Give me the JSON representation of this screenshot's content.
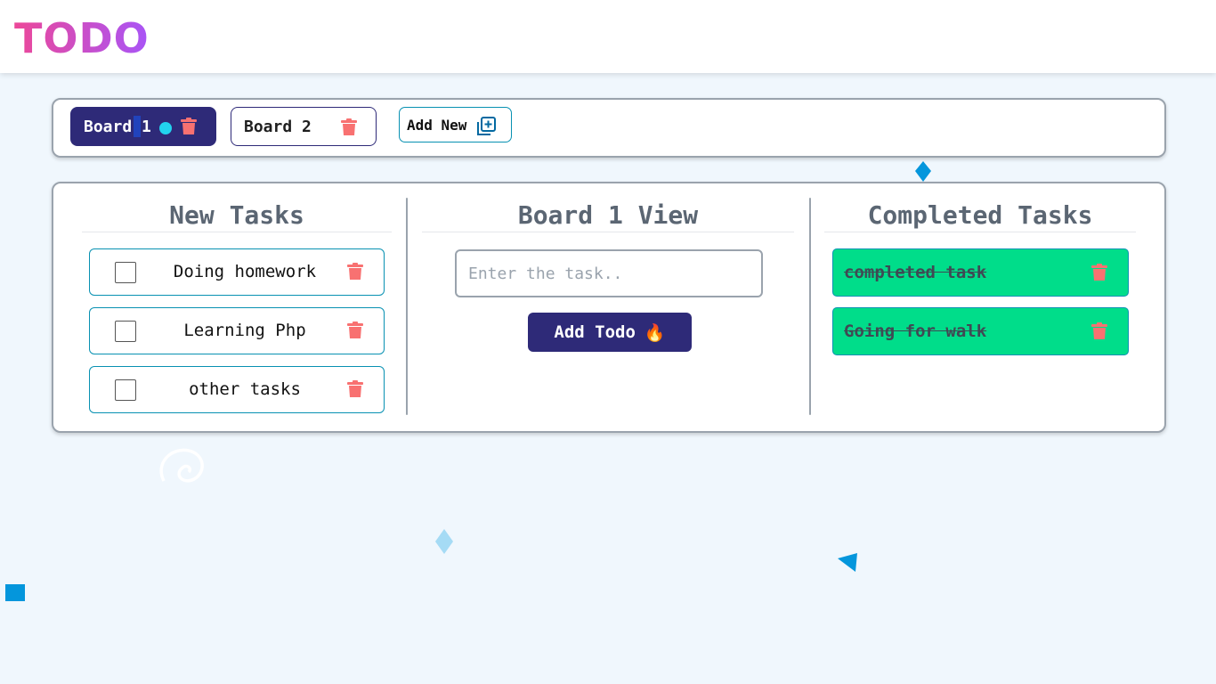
{
  "app": {
    "title": "TODO"
  },
  "boards": [
    {
      "label": "Board 1",
      "active": true
    },
    {
      "label": "Board 2",
      "active": false
    }
  ],
  "add_new_label": "Add New",
  "columns": {
    "new_tasks": {
      "title": "New Tasks",
      "items": [
        {
          "text": "Doing homework",
          "checked": false
        },
        {
          "text": "Learning Php",
          "checked": false
        },
        {
          "text": "other tasks",
          "checked": false
        }
      ]
    },
    "board_view": {
      "title": "Board 1 View",
      "input_value": "",
      "input_placeholder": "Enter the task..",
      "button_label": "Add Todo",
      "button_emoji": "🔥"
    },
    "completed": {
      "title": "Completed Tasks",
      "items": [
        {
          "text": "completed task"
        },
        {
          "text": "Going for walk"
        }
      ]
    }
  },
  "icons": {
    "trash": "trash-icon",
    "add": "add-square-icon"
  },
  "colors": {
    "accent": "#2e2a78",
    "trash": "#f87171",
    "done": "#00dd8a",
    "outline": "#0891b2",
    "logo_from": "#ec4899",
    "logo_to": "#a855f7"
  }
}
